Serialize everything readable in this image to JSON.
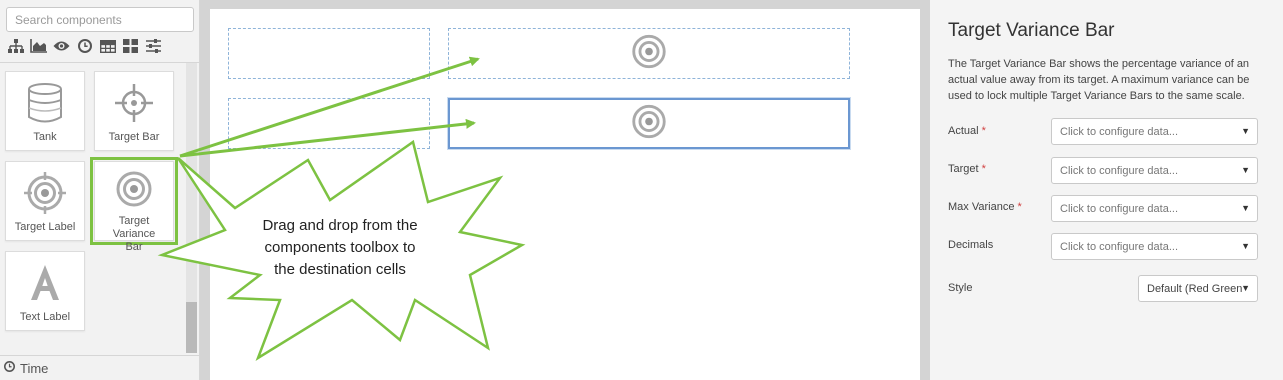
{
  "toolbox": {
    "search_placeholder": "Search components",
    "category_icons": [
      "hierarchy-icon",
      "area-chart-icon",
      "eye-icon",
      "clock-icon",
      "table-icon",
      "grid-icon",
      "sliders-icon"
    ],
    "components": [
      {
        "label": "Tank",
        "icon": "tank-icon"
      },
      {
        "label": "Target Bar",
        "icon": "crosshair-icon"
      },
      {
        "label": "Target Label",
        "icon": "target-icon"
      },
      {
        "label": "Target Variance Bar",
        "label_line1": "Target Variance",
        "label_line2": "Bar",
        "icon": "target-icon",
        "selected": true
      },
      {
        "label": "Text Label",
        "icon": "letter-a-icon"
      }
    ],
    "time_section": "Time"
  },
  "callout": {
    "line1": "Drag and drop from the",
    "line2": "components toolbox to",
    "line3": "the destination cells",
    "border_color": "#7dc242"
  },
  "panel": {
    "title": "Target Variance Bar",
    "description": "The Target Variance Bar shows the percentage variance of an actual value away from its target. A maximum variance can be used to lock multiple Target Variance Bars to the same scale.",
    "fields": [
      {
        "label": "Actual",
        "required": "*",
        "value": "Click to configure data..."
      },
      {
        "label": "Target",
        "required": "*",
        "value": "Click to configure data..."
      },
      {
        "label": "Max Variance",
        "required": "*",
        "value": "Click to configure data..."
      },
      {
        "label": "Decimals",
        "required": "",
        "value": "Click to configure data..."
      }
    ],
    "style": {
      "label": "Style",
      "value": "Default (Red Green"
    }
  },
  "colors": {
    "accent_green": "#7dc242",
    "cell_border": "#8fb4d9",
    "active_cell": "#6b97d1",
    "required": "#d04040"
  }
}
